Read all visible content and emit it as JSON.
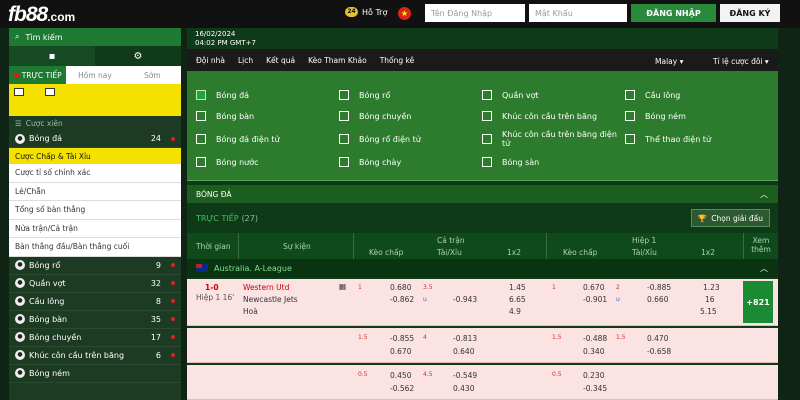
{
  "header": {
    "logo": "fb88",
    "logo_suffix": ".com",
    "help": "Hỗ Trợ",
    "username_placeholder": "Tên Đăng Nhập",
    "password_placeholder": "Mật Khẩu",
    "login_label": "ĐĂNG NHẬP",
    "register_label": "ĐĂNG KÝ"
  },
  "sidebar": {
    "search": "Tìm kiếm",
    "tabs": [
      "TRỰC TIẾP",
      "Hôm nay",
      "Sớm"
    ],
    "section": "Cược xiên",
    "sports_top": [
      {
        "name": "Bóng đá",
        "count": "24"
      }
    ],
    "bet_types": [
      "Cược Chấp & Tài Xỉu",
      "Cược tỉ số chính xác",
      "Lẻ/Chẵn",
      "Tổng số bàn thắng",
      "Nửa trận/Cả trận",
      "Bàn thắng đầu/Bàn thắng cuối"
    ],
    "sports": [
      {
        "name": "Bóng rổ",
        "count": "9"
      },
      {
        "name": "Quần vợt",
        "count": "32"
      },
      {
        "name": "Cầu lông",
        "count": "8"
      },
      {
        "name": "Bóng bàn",
        "count": "35"
      },
      {
        "name": "Bóng chuyền",
        "count": "17"
      },
      {
        "name": "Khúc côn cầu trên băng",
        "count": "6"
      },
      {
        "name": "Bóng ném",
        "count": ""
      }
    ]
  },
  "main": {
    "date": "16/02/2024",
    "time": "04:02 PM GMT+7",
    "nav": [
      "Đội nhà",
      "Lịch",
      "Kết quả",
      "Kèo Tham Khảo",
      "Thống kê"
    ],
    "odds_type": "Malay",
    "rate_label": "Tỉ lệ cược đôi",
    "filters": [
      {
        "label": "Bóng đá",
        "checked": true
      },
      {
        "label": "Bóng rổ"
      },
      {
        "label": "Quần vợt"
      },
      {
        "label": "Cầu lông"
      },
      {
        "label": "Bóng bàn"
      },
      {
        "label": "Bóng chuyền"
      },
      {
        "label": "Khúc côn cầu trên băng"
      },
      {
        "label": "Bóng ném"
      },
      {
        "label": "Bóng đá điện tử"
      },
      {
        "label": "Bóng rổ điện tử"
      },
      {
        "label": "Khúc côn cầu trên băng điện tử"
      },
      {
        "label": "Thể thao điện tử"
      },
      {
        "label": "Bóng nước"
      },
      {
        "label": "Bóng chày"
      },
      {
        "label": "Bóng sàn"
      }
    ],
    "section_title": "BÓNG ĐÁ",
    "live_title": "TRỰC TIẾP",
    "live_count": "(27)",
    "choose_league": "Chọn giải đấu",
    "columns": {
      "time": "Thời gian",
      "event": "Sự kiện",
      "full": "Cả trận",
      "half": "Hiệp 1",
      "hdp": "Kèo chấp",
      "ou": "Tài/Xỉu",
      "x12": "1x2",
      "more": "Xem thêm"
    },
    "league": "Australia. A-League",
    "match": {
      "score": "1-0",
      "period": "Hiệp 1 16'",
      "home": "Western Utd",
      "away": "Newcastle Jets",
      "draw": "Hoà",
      "more": "+821",
      "r1": {
        "h": "1",
        "hdp1": "0.680",
        "hdp2": "-0.862",
        "ou": "3.5",
        "oul": "u",
        "ou1": "-0.943",
        "ou2": "1.45",
        "x1": "6.65",
        "x2": "4.9",
        "hh": "1",
        "hh1": "0.670",
        "hh2": "-0.901",
        "ho": "2",
        "hol": "u",
        "ho1": "-0.885",
        "ho2": "0.660",
        "hx1": "1.23",
        "hx2": "16",
        "hx3": "5.15",
        "oua": "-0.943"
      }
    },
    "row2": {
      "a": "1.5",
      "b": "-0.855",
      "c": "0.670",
      "d": "4",
      "e": "-0.813",
      "f": "0.640",
      "g": "1.5",
      "h": "-0.488",
      "i": "0.340",
      "j": "1.5",
      "k": "0.470",
      "l": "-0.658"
    },
    "row3": {
      "a": "0.5",
      "b": "0.450",
      "c": "-0.562",
      "d": "4.5",
      "e": "-0.549",
      "f": "0.430",
      "g": "0.5",
      "h": "0.230",
      "i": "-0.345"
    }
  }
}
